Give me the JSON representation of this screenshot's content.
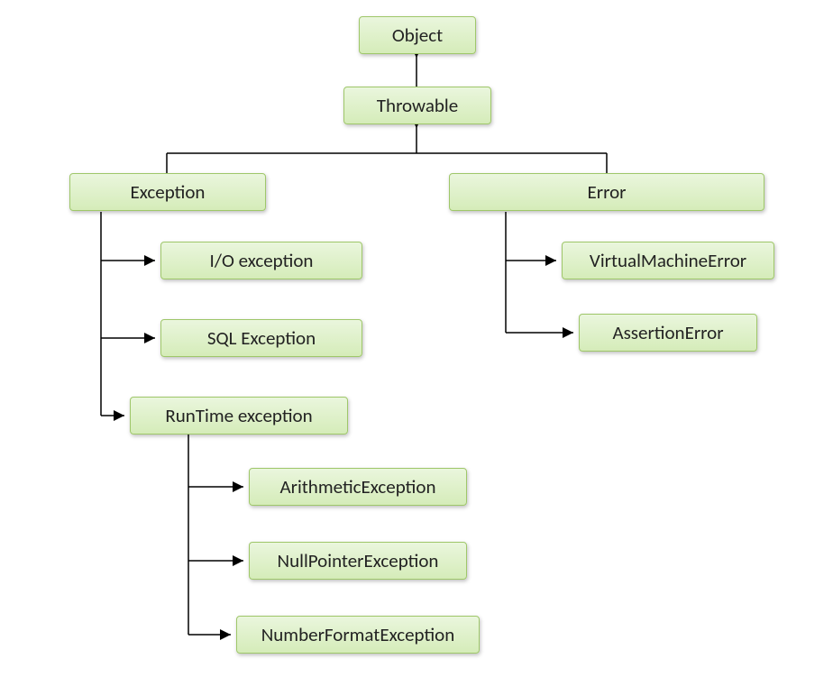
{
  "nodes": {
    "object": "Object",
    "throwable": "Throwable",
    "exception": "Exception",
    "error": "Error",
    "ioexception": "I/O exception",
    "sqlexception": "SQL Exception",
    "runtime": "RunTime exception",
    "arithmetic": "ArithmeticException",
    "nullpointer": "NullPointerException",
    "numberformat": "NumberFormatException",
    "vmerror": "VirtualMachineError",
    "assertion": "AssertionError"
  }
}
